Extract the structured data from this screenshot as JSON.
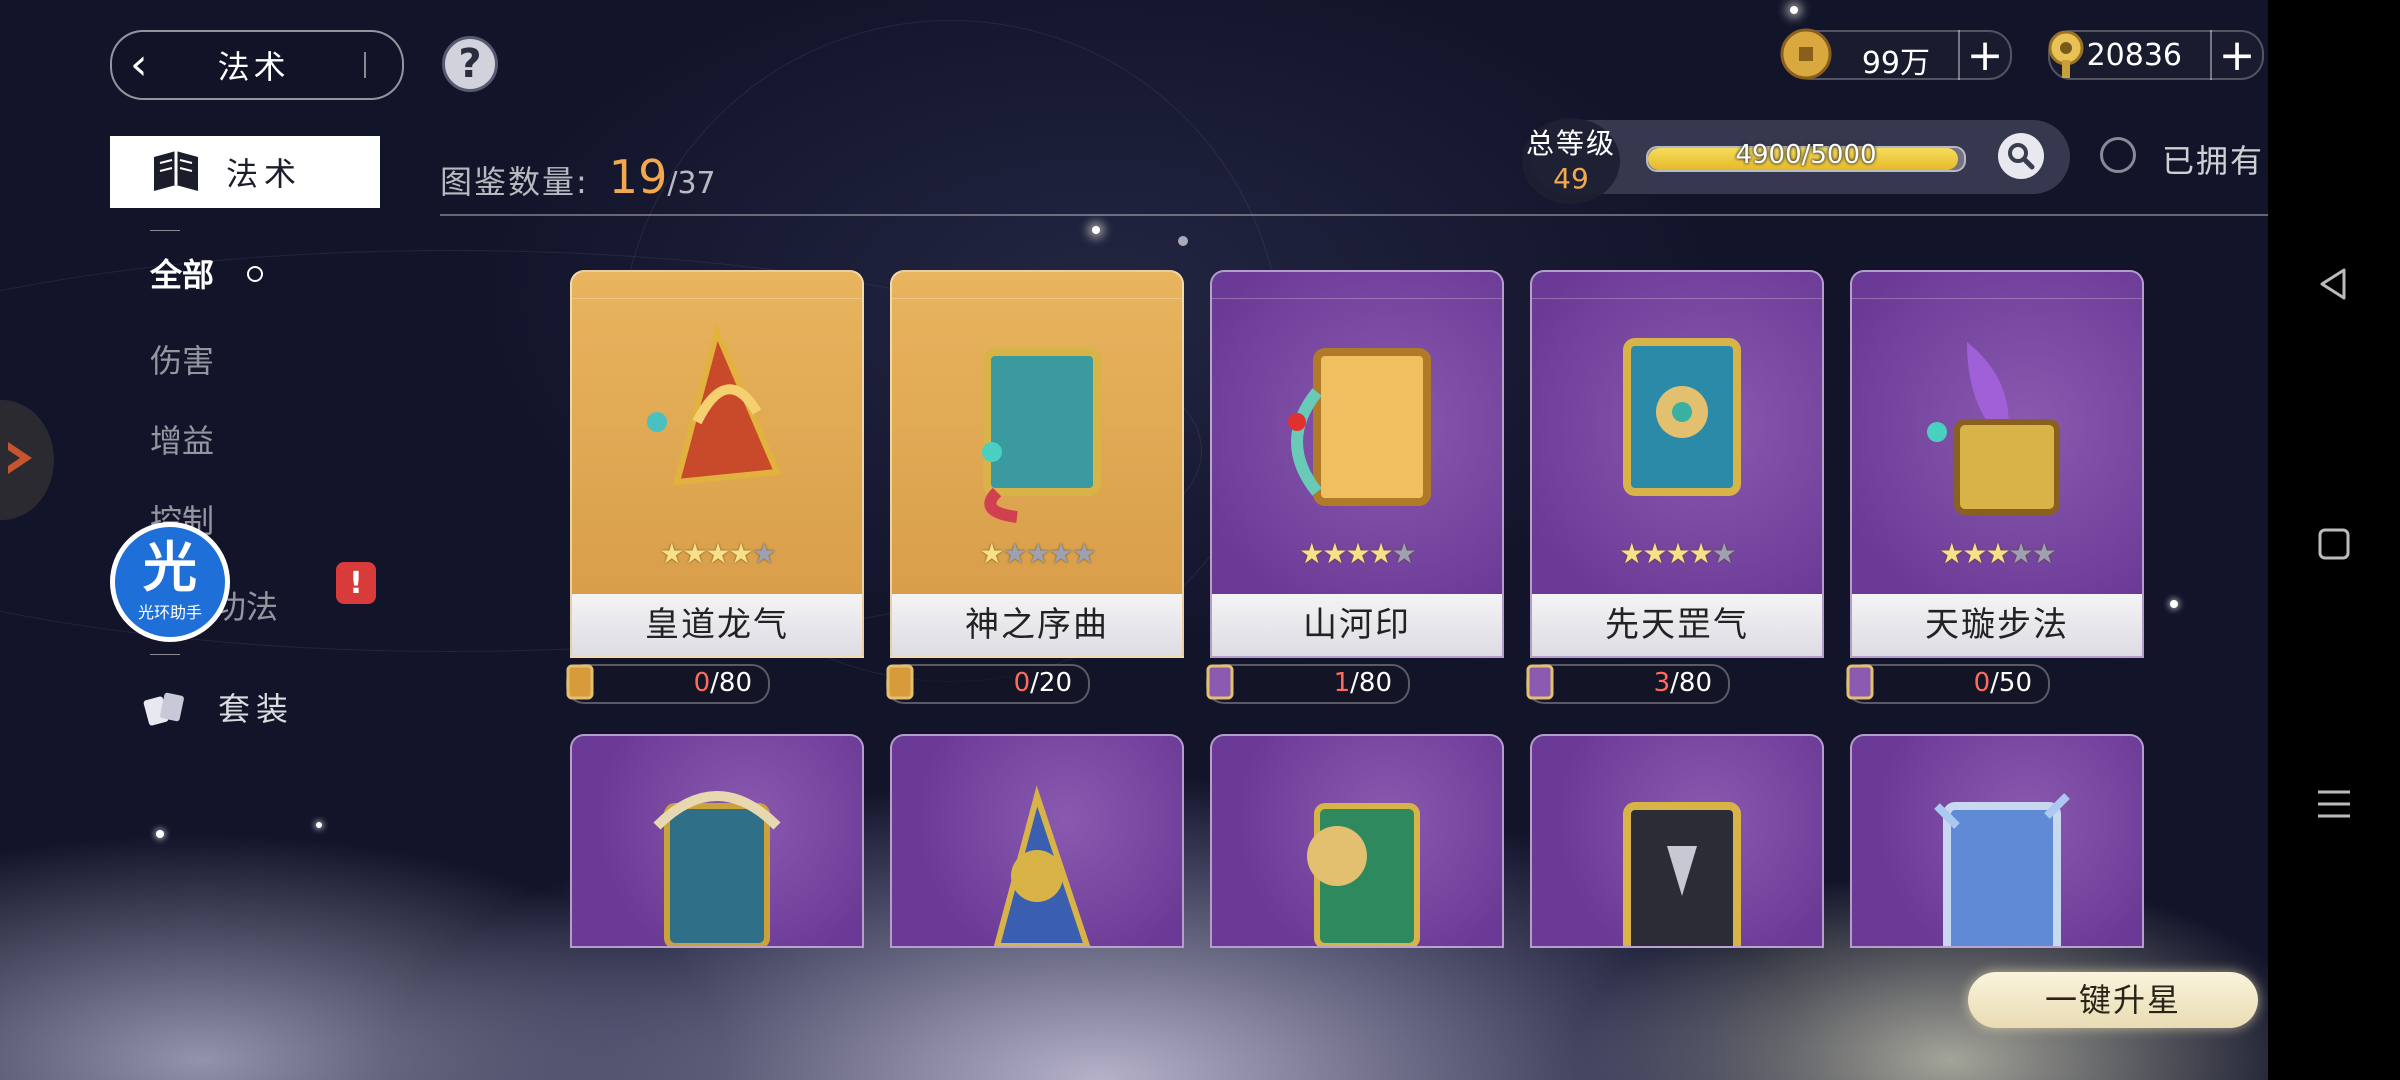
{
  "header": {
    "title": "法术",
    "help_icon": "?"
  },
  "currencies": [
    {
      "name": "coin-icon",
      "value": "99万"
    },
    {
      "name": "key-icon",
      "value": "20836"
    }
  ],
  "sidebar": {
    "section_title": "法术",
    "categories": [
      "全部",
      "伤害",
      "增益",
      "控制",
      "功法"
    ],
    "active": "全部",
    "suit_label": "套装",
    "alert_badge": "!"
  },
  "overlay": {
    "halo_big": "光",
    "halo_small": "光环助手"
  },
  "collection": {
    "label": "图鉴数量:",
    "count": "19",
    "total": "/37"
  },
  "level": {
    "label": "总等级",
    "value": "49",
    "exp_text": "4900/5000",
    "exp_fraction": 0.98
  },
  "filter": {
    "owned_label": "已拥有"
  },
  "cards": [
    {
      "name": "皇道龙气",
      "stars": 4,
      "max_stars": 5,
      "shard_have": "0",
      "shard_need": "/80",
      "color": "gold"
    },
    {
      "name": "神之序曲",
      "stars": 1,
      "max_stars": 5,
      "shard_have": "0",
      "shard_need": "/20",
      "color": "gold"
    },
    {
      "name": "山河印",
      "stars": 4,
      "max_stars": 5,
      "shard_have": "1",
      "shard_need": "/80",
      "color": "purple"
    },
    {
      "name": "先天罡气",
      "stars": 4,
      "max_stars": 5,
      "shard_have": "3",
      "shard_need": "/80",
      "color": "purple"
    },
    {
      "name": "天璇步法",
      "stars": 3,
      "max_stars": 5,
      "shard_have": "0",
      "shard_need": "/50",
      "color": "purple"
    }
  ],
  "actions": {
    "one_key_star": "一键升星"
  }
}
